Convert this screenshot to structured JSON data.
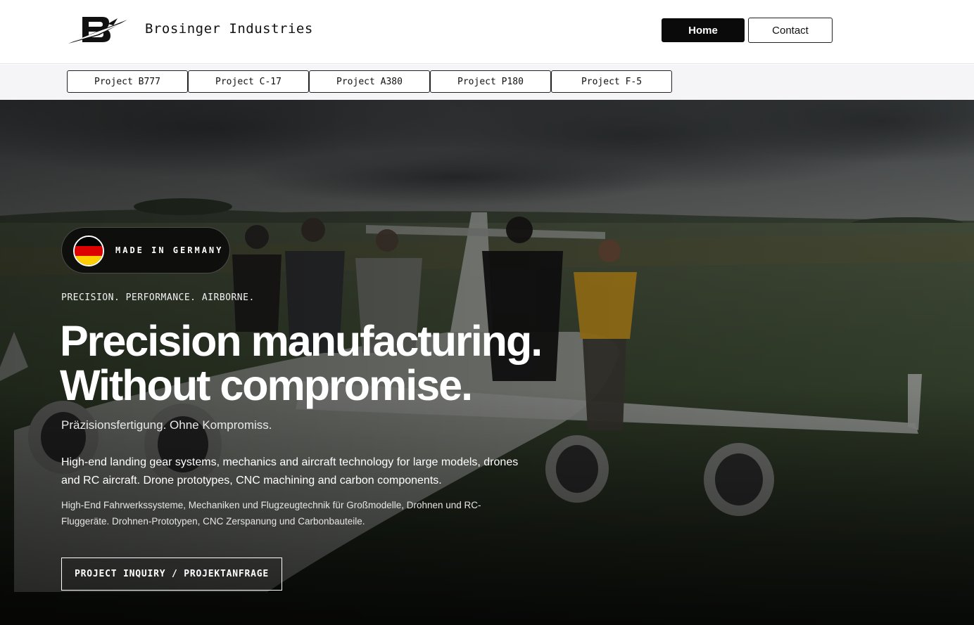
{
  "header": {
    "brand": "Brosinger Industries",
    "nav": {
      "home": "Home",
      "contact": "Contact"
    }
  },
  "projects": [
    "Project B777",
    "Project C-17",
    "Project A380",
    "Project P180",
    "Project F-5"
  ],
  "hero": {
    "badge": "MADE IN GERMANY",
    "tagline": "PRECISION. PERFORMANCE. AIRBORNE.",
    "headline_1": "Precision manufacturing.",
    "headline_2": "Without compromise.",
    "subtitle_de": "Präzisionsfertigung. Ohne Kompromiss.",
    "description_en": "High-end landing gear systems, mechanics and aircraft technology for large models, drones and RC aircraft. Drone prototypes, CNC machining and carbon components.",
    "description_de": "High-End Fahrwerkssysteme, Mechaniken und Flugzeugtechnik für Großmodelle, Drohnen und RC-Fluggeräte. Drohnen-Prototypen, CNC Zerspanung und Carbonbauteile.",
    "cta": "PROJECT INQUIRY / PROJEKTANFRAGE"
  },
  "colors": {
    "flag_black": "#000000",
    "flag_red": "#dd0000",
    "flag_gold": "#ffce00",
    "primary": "#0a0a0a"
  }
}
